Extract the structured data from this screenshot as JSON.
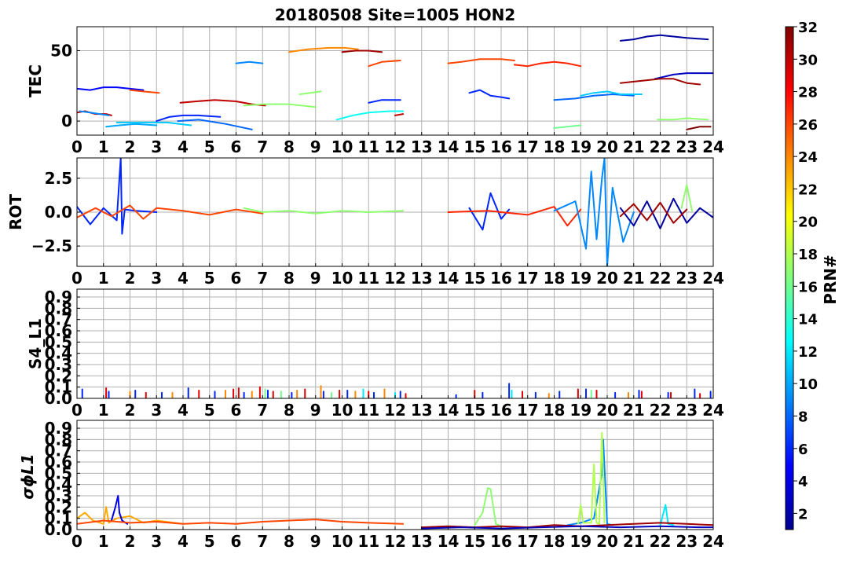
{
  "chart_data": [
    {
      "type": "line",
      "id": "tec",
      "title": "20180508 Site=1005 HON2",
      "ylabel": "TEC",
      "xlim": [
        0,
        24
      ],
      "ylim": [
        -10,
        67
      ],
      "yticks": [
        0,
        50
      ],
      "ytick_labels": [
        "0",
        "50"
      ],
      "xticks": [
        0,
        1,
        2,
        3,
        4,
        5,
        6,
        7,
        8,
        9,
        10,
        11,
        12,
        13,
        14,
        15,
        16,
        17,
        18,
        19,
        20,
        21,
        22,
        23,
        24
      ],
      "grid": true,
      "series": [
        {
          "prn": 5,
          "x": [
            0,
            0.5,
            1.0,
            1.5,
            2.0,
            2.5
          ],
          "y": [
            23,
            22,
            24,
            24,
            23,
            22
          ]
        },
        {
          "prn": 26,
          "x": [
            2.0,
            2.5,
            3.1
          ],
          "y": [
            22,
            21,
            20
          ]
        },
        {
          "prn": 30,
          "x": [
            0,
            0.3,
            0.7,
            1.1,
            1.3
          ],
          "y": [
            6,
            7,
            5,
            5,
            4
          ]
        },
        {
          "prn": 9,
          "x": [
            0.1,
            0.5,
            1.2
          ],
          "y": [
            7,
            6,
            4
          ]
        },
        {
          "prn": 10,
          "x": [
            1.1,
            1.6,
            2.2,
            3.0
          ],
          "y": [
            -4,
            -3,
            -2,
            -3
          ]
        },
        {
          "prn": 11,
          "x": [
            1.5,
            2.4,
            3.4,
            4.3
          ],
          "y": [
            -1,
            -1,
            -1,
            -3
          ]
        },
        {
          "prn": 6,
          "x": [
            3.0,
            3.5,
            4.0,
            4.6,
            5.4
          ],
          "y": [
            0,
            3,
            4,
            4,
            3
          ]
        },
        {
          "prn": 8,
          "x": [
            3.8,
            4.6,
            5.6,
            6.6
          ],
          "y": [
            0,
            1,
            -2,
            -6
          ]
        },
        {
          "prn": 30,
          "x": [
            3.9,
            4.5,
            5.2,
            6.0,
            6.6,
            7.1
          ],
          "y": [
            13,
            14,
            15,
            14,
            12,
            11
          ]
        },
        {
          "prn": 17,
          "x": [
            6.3,
            7.0,
            8.0,
            9.0
          ],
          "y": [
            11,
            12,
            12,
            10
          ]
        },
        {
          "prn": 9,
          "x": [
            6.0,
            6.5,
            7.0
          ],
          "y": [
            41,
            42,
            41
          ]
        },
        {
          "prn": 24,
          "x": [
            8.0,
            8.7,
            9.5,
            10.1,
            10.6
          ],
          "y": [
            49,
            51,
            52,
            52,
            51
          ]
        },
        {
          "prn": 31,
          "x": [
            10.0,
            10.5,
            11.0,
            11.5
          ],
          "y": [
            49,
            50,
            50,
            49
          ]
        },
        {
          "prn": 17,
          "x": [
            8.4,
            8.8,
            9.2
          ],
          "y": [
            19,
            20,
            21
          ]
        },
        {
          "prn": 13,
          "x": [
            9.8,
            10.4,
            11.0,
            11.8,
            12.3
          ],
          "y": [
            1,
            4,
            6,
            7,
            7
          ]
        },
        {
          "prn": 26,
          "x": [
            11.0,
            11.5,
            12.2
          ],
          "y": [
            39,
            42,
            43
          ]
        },
        {
          "prn": 6,
          "x": [
            11.0,
            11.5,
            12.2
          ],
          "y": [
            13,
            15,
            15
          ]
        },
        {
          "prn": 30,
          "x": [
            12.0,
            12.3
          ],
          "y": [
            4,
            5
          ]
        },
        {
          "prn": 26,
          "x": [
            14.0,
            14.5,
            15.2,
            16.0,
            16.5
          ],
          "y": [
            41,
            42,
            44,
            44,
            43
          ]
        },
        {
          "prn": 27,
          "x": [
            16.5,
            17.0,
            17.5,
            18.0,
            18.5,
            19.0
          ],
          "y": [
            40,
            39,
            41,
            42,
            41,
            39
          ]
        },
        {
          "prn": 6,
          "x": [
            14.8,
            15.2,
            15.6,
            16.0,
            16.3
          ],
          "y": [
            20,
            22,
            18,
            17,
            16
          ]
        },
        {
          "prn": 8,
          "x": [
            18.0,
            18.8,
            19.5,
            20.2,
            21.0
          ],
          "y": [
            15,
            16,
            18,
            19,
            18
          ]
        },
        {
          "prn": 11,
          "x": [
            19.0,
            19.5,
            20.0,
            20.5,
            21.3
          ],
          "y": [
            18,
            20,
            21,
            19,
            19
          ]
        },
        {
          "prn": 16,
          "x": [
            18.0,
            18.5,
            19.0
          ],
          "y": [
            -5,
            -4,
            -3
          ]
        },
        {
          "prn": 2,
          "x": [
            20.5,
            21.0,
            21.5,
            22.0,
            22.5,
            23.0,
            23.8
          ],
          "y": [
            57,
            58,
            60,
            61,
            60,
            59,
            58
          ]
        },
        {
          "prn": 3,
          "x": [
            21.8,
            22.5,
            23.0,
            24.0
          ],
          "y": [
            30,
            33,
            34,
            34
          ]
        },
        {
          "prn": 31,
          "x": [
            20.5,
            21.0,
            21.5,
            22.0,
            22.5,
            23.0,
            23.5
          ],
          "y": [
            27,
            28,
            29,
            30,
            30,
            27,
            26
          ]
        },
        {
          "prn": 17,
          "x": [
            21.9,
            22.5,
            23.0,
            23.8
          ],
          "y": [
            1,
            1,
            2,
            1
          ]
        },
        {
          "prn": 32,
          "x": [
            23.0,
            23.5,
            23.9
          ],
          "y": [
            -6,
            -4,
            -4
          ]
        }
      ]
    },
    {
      "type": "line",
      "id": "rot",
      "ylabel": "ROT",
      "xlim": [
        0,
        24
      ],
      "ylim": [
        -4,
        4
      ],
      "yticks": [
        -2.5,
        0,
        2.5
      ],
      "ytick_labels": [
        "−2.5",
        "0.0",
        "2.5"
      ],
      "xticks": [
        0,
        1,
        2,
        3,
        4,
        5,
        6,
        7,
        8,
        9,
        10,
        11,
        12,
        13,
        14,
        15,
        16,
        17,
        18,
        19,
        20,
        21,
        22,
        23,
        24
      ],
      "grid": true,
      "series": [
        {
          "prn": 6,
          "x": [
            0,
            0.5,
            1.0,
            1.5,
            1.65,
            1.7,
            1.8,
            2.2,
            3.0
          ],
          "y": [
            0.4,
            -0.9,
            0.3,
            -0.6,
            4.0,
            -1.6,
            0.2,
            0.1,
            0.0
          ]
        },
        {
          "prn": 26,
          "x": [
            0,
            0.7,
            1.3,
            2.0,
            2.5,
            3.0,
            4.0,
            5.0,
            6.0,
            7.0
          ],
          "y": [
            -0.4,
            0.3,
            -0.3,
            0.5,
            -0.5,
            0.3,
            0.1,
            -0.2,
            0.2,
            -0.1
          ]
        },
        {
          "prn": 17,
          "x": [
            6.3,
            7.0,
            8.0,
            9.0,
            10.0,
            11.0,
            12.3
          ],
          "y": [
            0.3,
            0.0,
            0.1,
            -0.1,
            0.1,
            0.0,
            0.1
          ]
        },
        {
          "prn": 6,
          "x": [
            14.8,
            15.3,
            15.6,
            16.0,
            16.3
          ],
          "y": [
            0.3,
            -1.3,
            1.4,
            -0.5,
            0.2
          ]
        },
        {
          "prn": 27,
          "x": [
            14.0,
            15.5,
            17.0,
            18.0,
            18.5,
            19.0
          ],
          "y": [
            0.0,
            0.1,
            -0.2,
            0.4,
            -1.0,
            0.2
          ]
        },
        {
          "prn": 9,
          "x": [
            18.0,
            18.8,
            19.2,
            19.4,
            19.6,
            19.8,
            19.9,
            20.0,
            20.2,
            20.6,
            21.0
          ],
          "y": [
            0.1,
            0.8,
            -2.7,
            3.0,
            -2.0,
            2.5,
            4.0,
            -4.0,
            1.8,
            -2.2,
            0.0
          ]
        },
        {
          "prn": 2,
          "x": [
            20.5,
            21.0,
            21.5,
            22.0,
            22.5,
            23.0,
            23.5,
            24.0
          ],
          "y": [
            0.3,
            -1.0,
            0.8,
            -1.2,
            1.0,
            -0.8,
            0.3,
            -0.4
          ]
        },
        {
          "prn": 31,
          "x": [
            20.5,
            21.0,
            21.5,
            22.0,
            22.5,
            23.0
          ],
          "y": [
            -0.3,
            0.6,
            -0.6,
            0.7,
            -0.8,
            0.2
          ]
        },
        {
          "prn": 17,
          "x": [
            22.8,
            23.0,
            23.2
          ],
          "y": [
            0.3,
            2.0,
            0.1
          ]
        }
      ]
    },
    {
      "type": "line",
      "id": "s4",
      "ylabel": "S4_L1",
      "xlim": [
        0,
        24
      ],
      "ylim": [
        0,
        0.97
      ],
      "yticks": [
        0.0,
        0.1,
        0.2,
        0.3,
        0.4,
        0.5,
        0.6,
        0.7,
        0.8,
        0.9
      ],
      "ytick_labels": [
        "0.0",
        "0.1",
        "0.2",
        "0.3",
        "0.4",
        "0.5",
        "0.6",
        "0.7",
        "0.8",
        "0.9"
      ],
      "xticks": [
        0,
        1,
        2,
        3,
        4,
        5,
        6,
        7,
        8,
        9,
        10,
        11,
        12,
        13,
        14,
        15,
        16,
        17,
        18,
        19,
        20,
        21,
        22,
        23,
        24
      ],
      "grid": true,
      "spikes": [
        {
          "prn": 6,
          "t": [
            0.2,
            1.2,
            2.2,
            3.2,
            4.2,
            5.2,
            6.3,
            7.2,
            8.1,
            9.3,
            10.2,
            11.2,
            12.2,
            14.3,
            15.3,
            16.3,
            17.3,
            18.2,
            19.2,
            20.3,
            21.2,
            22.3,
            23.3,
            23.9
          ],
          "h": [
            0.08,
            0.06,
            0.07,
            0.05,
            0.09,
            0.06,
            0.05,
            0.07,
            0.05,
            0.06,
            0.07,
            0.05,
            0.06,
            0.03,
            0.05,
            0.13,
            0.05,
            0.06,
            0.08,
            0.05,
            0.07,
            0.05,
            0.08,
            0.06
          ]
        },
        {
          "prn": 29,
          "t": [
            1.1,
            2.6,
            4.6,
            5.9,
            6.1,
            6.9,
            7.4,
            8.6,
            9.9,
            11.0,
            12.4,
            15.0,
            16.8,
            18.9,
            19.6,
            21.3,
            22.4,
            23.5
          ],
          "h": [
            0.09,
            0.05,
            0.07,
            0.08,
            0.09,
            0.1,
            0.06,
            0.08,
            0.07,
            0.06,
            0.04,
            0.07,
            0.06,
            0.08,
            0.07,
            0.06,
            0.05,
            0.04
          ]
        },
        {
          "prn": 24,
          "t": [
            2.0,
            3.6,
            5.6,
            6.6,
            8.3,
            9.2,
            10.5,
            11.6,
            17.8,
            20.8
          ],
          "h": [
            0.06,
            0.05,
            0.07,
            0.06,
            0.07,
            0.11,
            0.06,
            0.08,
            0.04,
            0.05
          ]
        },
        {
          "prn": 16,
          "t": [
            7.1,
            7.7,
            9.6,
            19.4
          ],
          "h": [
            0.08,
            0.06,
            0.05,
            0.07
          ]
        },
        {
          "prn": 12,
          "t": [
            10.8,
            12.0,
            16.4
          ],
          "h": [
            0.08,
            0.05,
            0.07
          ]
        }
      ]
    },
    {
      "type": "line",
      "id": "sigma",
      "ylabel": "σϕL1",
      "xlim": [
        0,
        24
      ],
      "ylim": [
        0,
        0.97
      ],
      "yticks": [
        0.0,
        0.1,
        0.2,
        0.3,
        0.4,
        0.5,
        0.6,
        0.7,
        0.8,
        0.9
      ],
      "ytick_labels": [
        "0.0",
        "0.1",
        "0.2",
        "0.3",
        "0.4",
        "0.5",
        "0.6",
        "0.7",
        "0.8",
        "0.9"
      ],
      "xticks": [
        0,
        1,
        2,
        3,
        4,
        5,
        6,
        7,
        8,
        9,
        10,
        11,
        12,
        13,
        14,
        15,
        16,
        17,
        18,
        19,
        20,
        21,
        22,
        23,
        24
      ],
      "grid": true,
      "series": [
        {
          "prn": 23,
          "x": [
            0,
            0.3,
            0.6,
            1.0,
            1.1,
            1.2,
            1.5,
            2.0,
            2.5,
            3.0,
            4.0
          ],
          "y": [
            0.1,
            0.15,
            0.08,
            0.05,
            0.2,
            0.06,
            0.1,
            0.12,
            0.06,
            0.08,
            0.05
          ]
        },
        {
          "prn": 4,
          "x": [
            1.3,
            1.45,
            1.55,
            1.6,
            1.7,
            1.9
          ],
          "y": [
            0.08,
            0.2,
            0.3,
            0.15,
            0.08,
            0.05
          ]
        },
        {
          "prn": 26,
          "x": [
            0,
            1.0,
            2.0,
            3.0,
            4.0,
            5.0,
            6.0,
            7.0,
            8.0,
            9.0,
            10.0,
            11.0,
            12.3
          ],
          "y": [
            0.05,
            0.08,
            0.06,
            0.07,
            0.05,
            0.06,
            0.05,
            0.07,
            0.08,
            0.09,
            0.07,
            0.06,
            0.05
          ]
        },
        {
          "prn": 17,
          "x": [
            15.0,
            15.3,
            15.5,
            15.6,
            15.8,
            16.0
          ],
          "y": [
            0.04,
            0.15,
            0.37,
            0.36,
            0.05,
            0.03
          ]
        },
        {
          "prn": 9,
          "x": [
            18.5,
            19.0,
            19.5,
            19.8,
            19.85,
            19.95,
            20.0,
            20.2
          ],
          "y": [
            0.04,
            0.06,
            0.1,
            0.5,
            0.8,
            0.3,
            0.05,
            0.04
          ]
        },
        {
          "prn": 18,
          "x": [
            18.9,
            19.0,
            19.1,
            19.4,
            19.5,
            19.6,
            19.7,
            19.8,
            19.9
          ],
          "y": [
            0.05,
            0.22,
            0.06,
            0.06,
            0.58,
            0.06,
            0.05,
            0.86,
            0.06
          ]
        },
        {
          "prn": 12,
          "x": [
            22.0,
            22.2,
            22.3,
            22.5
          ],
          "y": [
            0.04,
            0.22,
            0.05,
            0.04
          ]
        },
        {
          "prn": 31,
          "x": [
            13.0,
            14.0,
            15.0,
            16.0,
            17.0,
            18.0,
            19.0,
            20.0,
            21.0,
            22.0,
            23.0,
            24.0
          ],
          "y": [
            0.02,
            0.03,
            0.02,
            0.03,
            0.02,
            0.04,
            0.03,
            0.04,
            0.05,
            0.06,
            0.05,
            0.04
          ]
        },
        {
          "prn": 3,
          "x": [
            13.0,
            14.5,
            16.0,
            17.5,
            19.0,
            20.5,
            22.0,
            23.5,
            24.0
          ],
          "y": [
            0.01,
            0.02,
            0.01,
            0.02,
            0.03,
            0.02,
            0.03,
            0.02,
            0.02
          ]
        }
      ]
    }
  ],
  "colorbar": {
    "label": "PRN#",
    "range": [
      1,
      32
    ],
    "ticks": [
      2,
      4,
      6,
      8,
      10,
      12,
      14,
      16,
      18,
      20,
      22,
      24,
      26,
      28,
      30,
      32
    ],
    "colormap": "jet"
  }
}
